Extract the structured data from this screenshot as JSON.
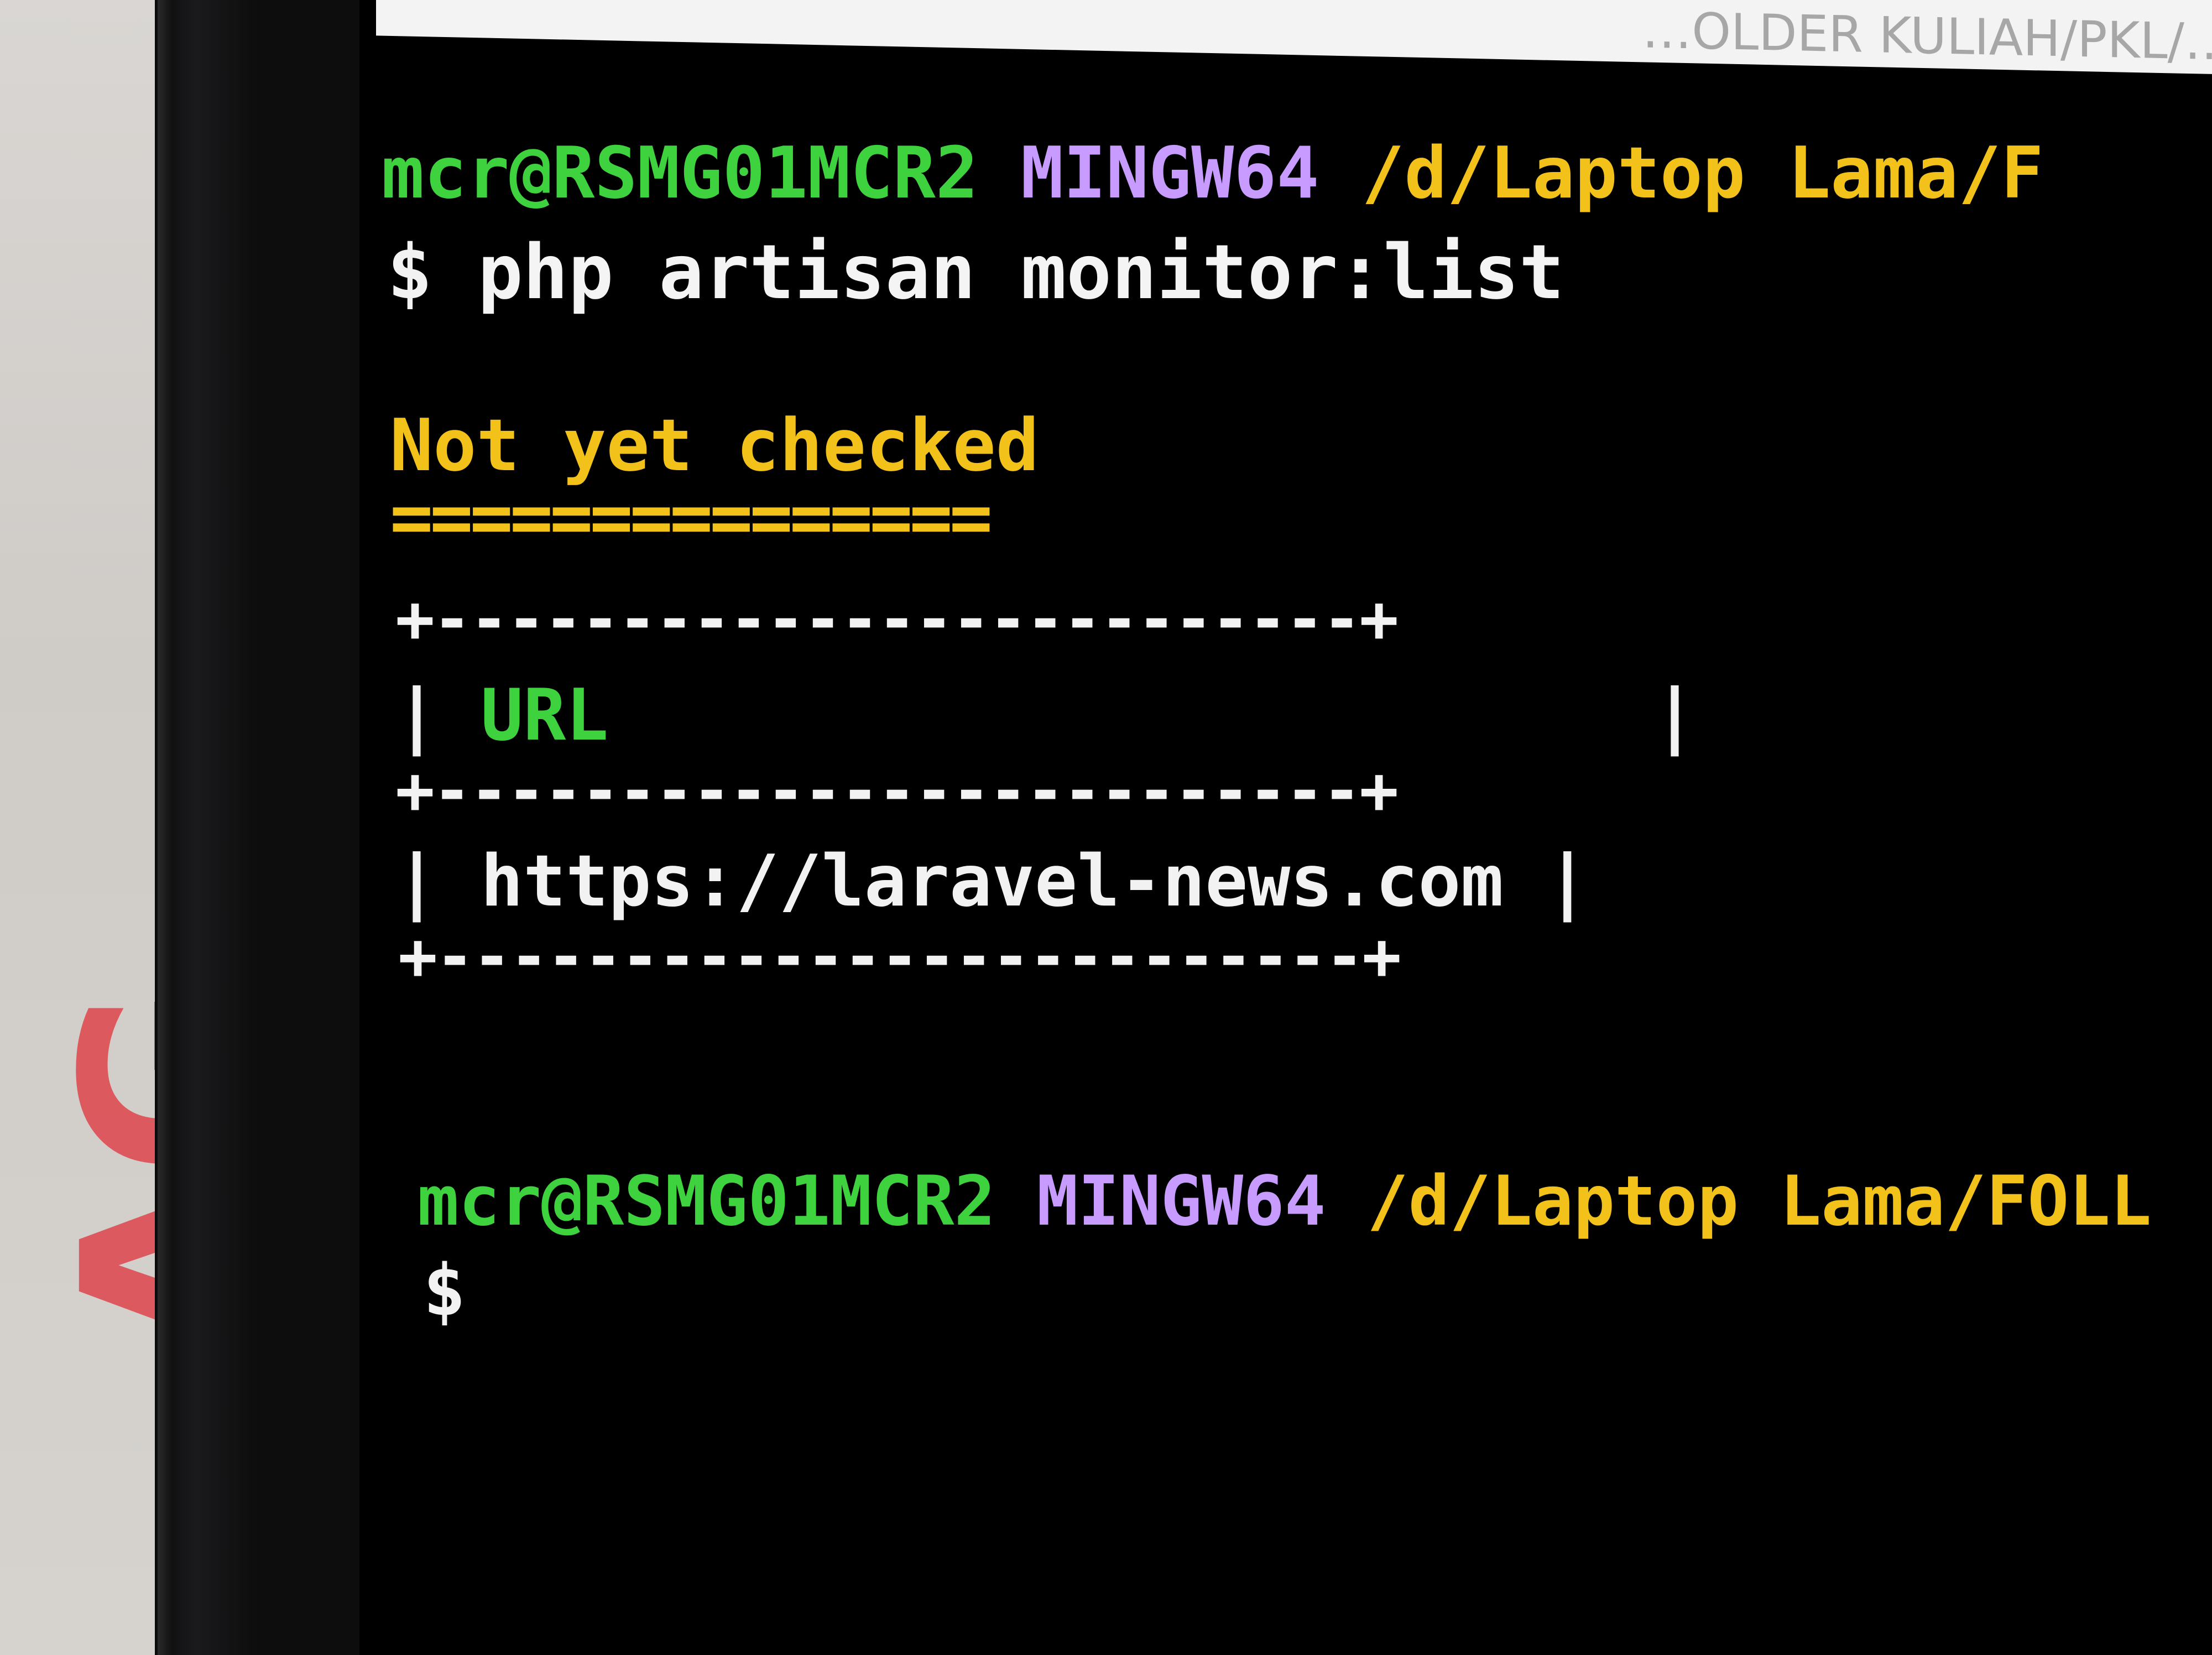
{
  "titlebar": {
    "path_text": "…OLDER KULIAH/PKL/…"
  },
  "prompt1": {
    "user_host": "mcr@RSMG01MCR2",
    "env": "MINGW64",
    "path": "/d/Laptop Lama/F"
  },
  "command": {
    "symbol": "$",
    "text": "php artisan monitor:list"
  },
  "section": {
    "heading": "Not yet checked",
    "underline": "==============="
  },
  "table": {
    "border_top": "+-------------------------+",
    "header_row": {
      "left": "|",
      "label": "URL",
      "right": "|"
    },
    "border_mid": "+-------------------------+",
    "rows": [
      {
        "left": "|",
        "value": "https://laravel-news.com",
        "right": "|"
      }
    ],
    "border_bottom": "+-------------------------+"
  },
  "prompt2": {
    "user_host": "mcr@RSMG01MCR2",
    "env": "MINGW64",
    "path": "/d/Laptop Lama/FOLL"
  },
  "cursor_prompt": {
    "symbol": "$"
  },
  "background": {
    "bag_print": "AG"
  },
  "colors": {
    "prompt_green": "#3fd23f",
    "env_purple": "#c79bff",
    "path_yellow": "#f2c21b",
    "text_white": "#f2f2f2",
    "terminal_bg": "#000000"
  }
}
